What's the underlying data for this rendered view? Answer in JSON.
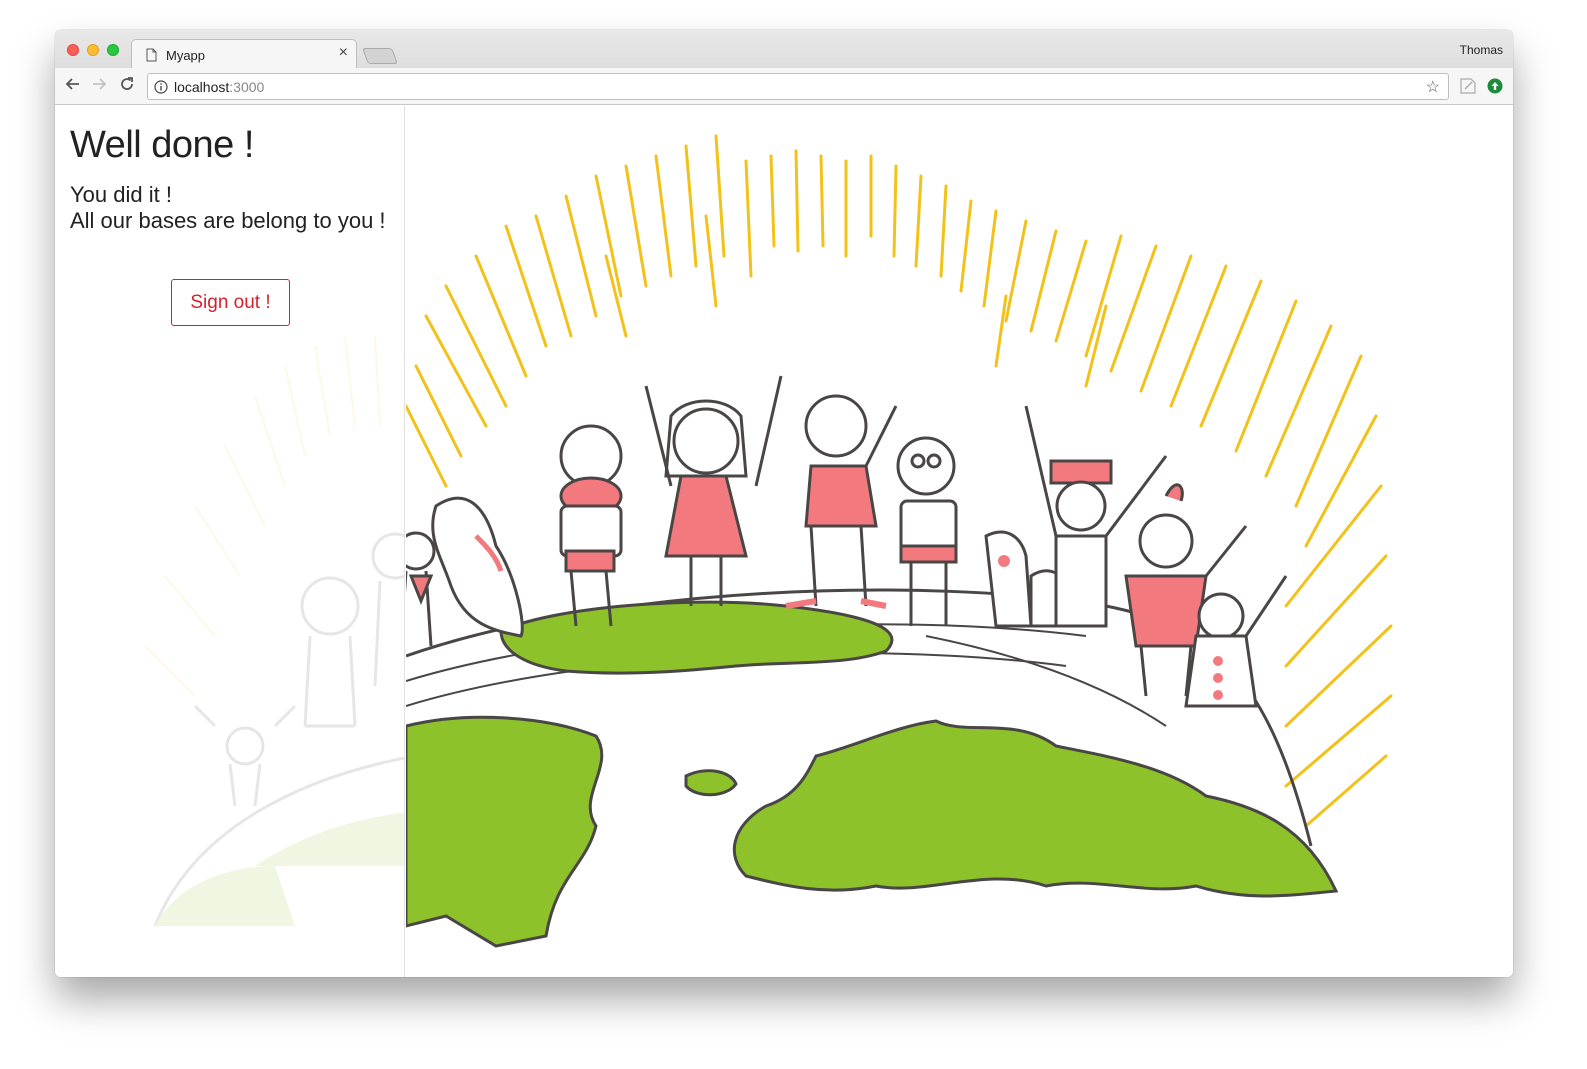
{
  "browser": {
    "tab": {
      "title": "Myapp",
      "close_glyph": "×"
    },
    "profile_name": "Thomas",
    "url": {
      "host": "localhost",
      "port": ":3000"
    },
    "icons": [
      "back-arrow-icon",
      "forward-arrow-icon",
      "reload-icon",
      "info-icon",
      "star-icon",
      "extension-icon",
      "upload-extension-icon"
    ]
  },
  "page": {
    "title": "Well done !",
    "lines": [
      "You did it !",
      "All our bases are belong to you !"
    ],
    "sign_out_label": "Sign out !"
  },
  "colors": {
    "accent_red": "#d8202c",
    "globe_green": "#8dc22a",
    "sun_yellow": "#f3c21a",
    "shirt_pink": "#f27a7f",
    "ink": "#4a4646"
  }
}
